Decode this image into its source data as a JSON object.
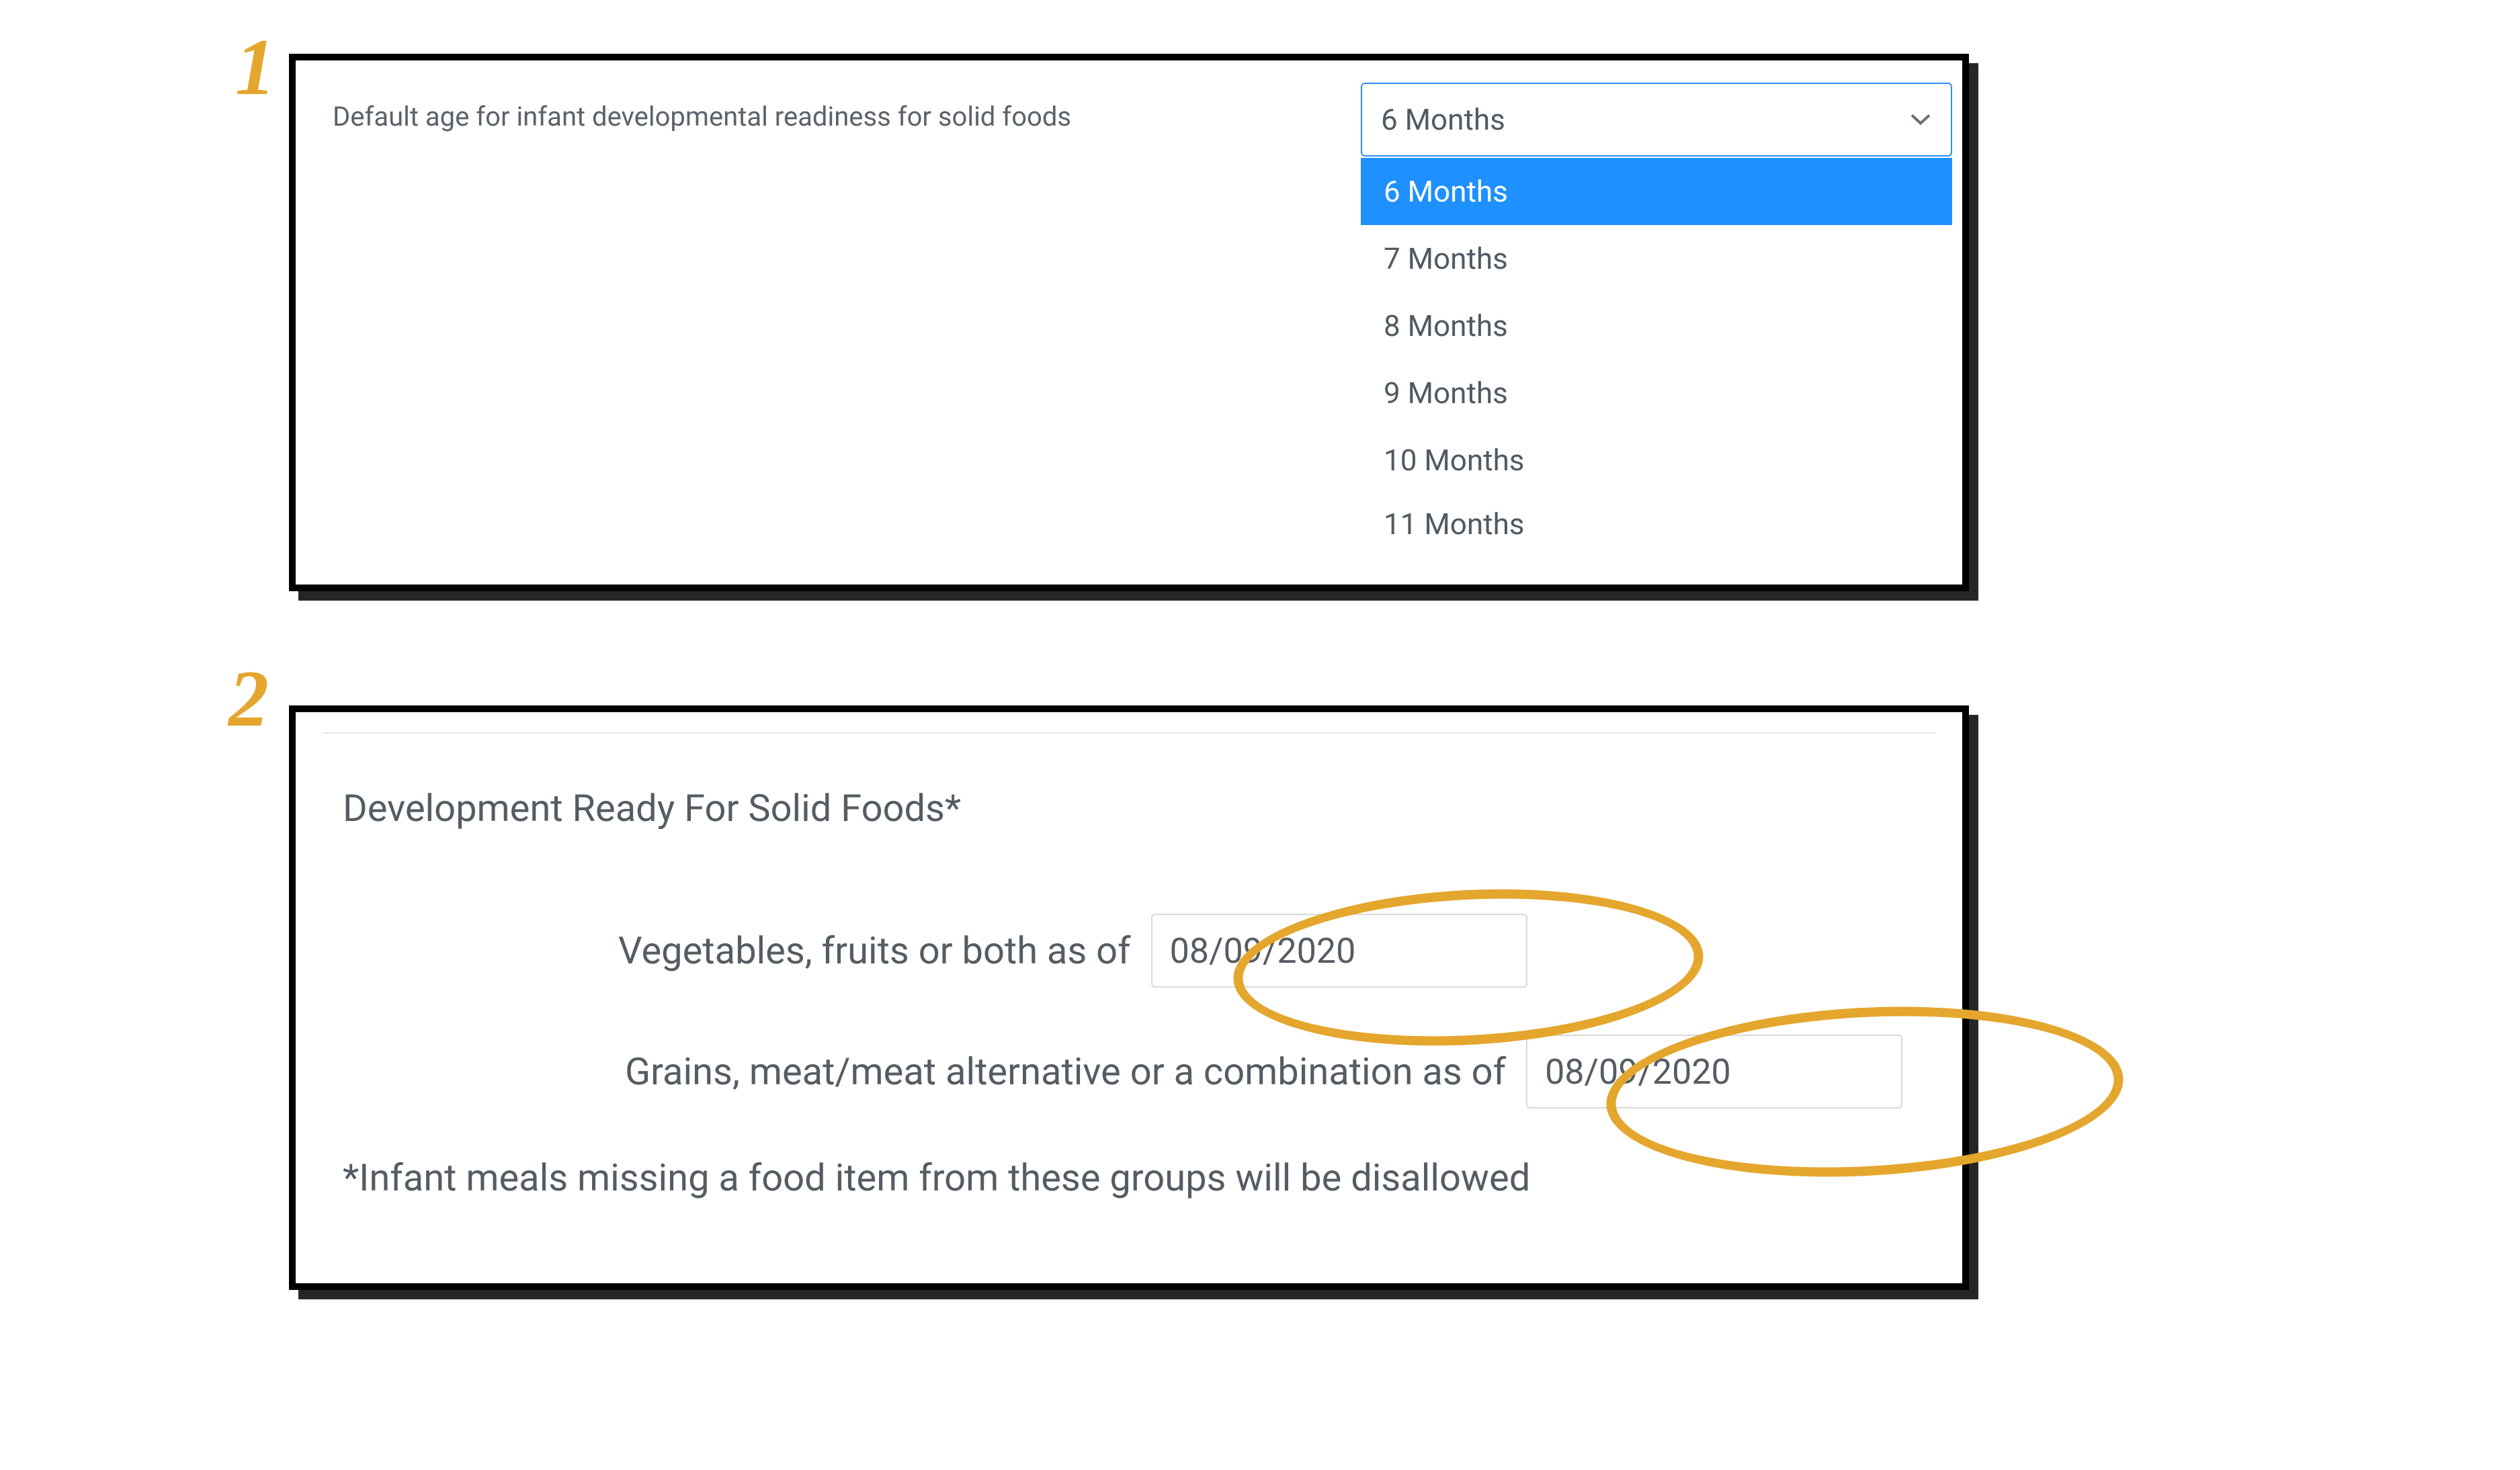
{
  "annotations": {
    "step1": "1",
    "step2": "2"
  },
  "panel1": {
    "label": "Default age for infant developmental readiness for solid foods",
    "selected_value": "6 Months",
    "options": [
      "6 Months",
      "7 Months",
      "8 Months",
      "9 Months",
      "10 Months",
      "11 Months"
    ]
  },
  "panel2": {
    "title": "Development Ready For Solid Foods*",
    "row1_label": "Vegetables, fruits or both as of",
    "row1_date": "08/09/2020",
    "row2_label": "Grains, meat/meat alternative or a combination as of",
    "row2_date": "08/09/2020",
    "footnote": "*Infant meals missing a food item from these groups will be disallowed"
  },
  "colors": {
    "annotation": "#e4a62d",
    "highlight_blue": "#1e90ff"
  }
}
